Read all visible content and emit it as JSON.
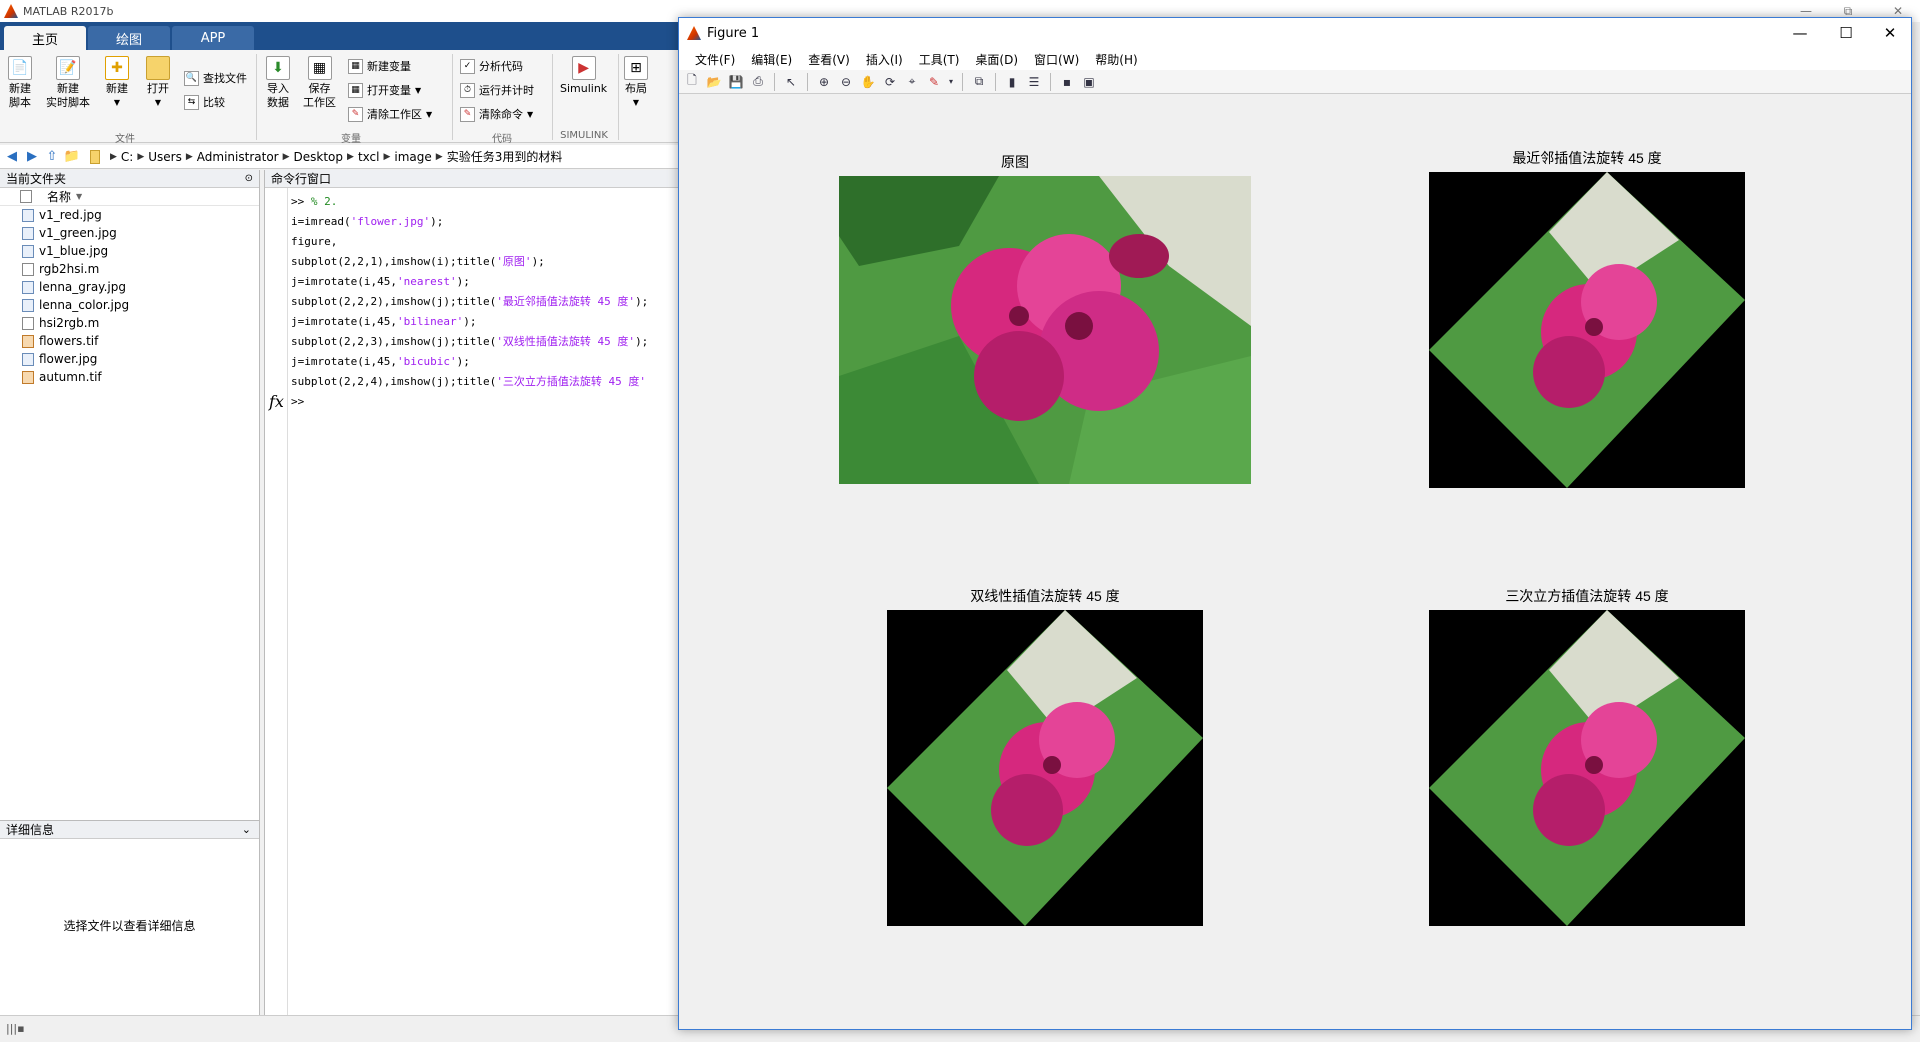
{
  "app_title": "MATLAB R2017b",
  "window_controls": {
    "minimize": "—",
    "restore": "⧉",
    "close": "✕"
  },
  "tabs": [
    "主页",
    "绘图",
    "APP"
  ],
  "ribbon": {
    "file": {
      "new_script": "新建\n脚本",
      "new_live_script": "新建\n实时脚本",
      "new": "新建",
      "open": "打开",
      "find_files": "查找文件",
      "compare": "比较",
      "group": "文件"
    },
    "variable": {
      "import": "导入\n数据",
      "save_ws": "保存\n工作区",
      "new_var": "新建变量",
      "open_var": "打开变量",
      "clear_ws": "清除工作区",
      "group": "变量"
    },
    "code": {
      "analyze": "分析代码",
      "run_time": "运行并计时",
      "clear_cmd": "清除命令",
      "group": "代码"
    },
    "simulink": {
      "label": "Simulink",
      "group": "SIMULINK"
    },
    "environment": {
      "layout": "布局"
    }
  },
  "address": {
    "crumbs": [
      "C:",
      "Users",
      "Administrator",
      "Desktop",
      "txcl",
      "image",
      "实验任务3用到的材料"
    ]
  },
  "current_folder": {
    "title": "当前文件夹",
    "column": "名称",
    "files": [
      {
        "name": "v1_red.jpg",
        "type": "img"
      },
      {
        "name": "v1_green.jpg",
        "type": "img"
      },
      {
        "name": "v1_blue.jpg",
        "type": "img"
      },
      {
        "name": "rgb2hsi.m",
        "type": "m"
      },
      {
        "name": "lenna_gray.jpg",
        "type": "img"
      },
      {
        "name": "lenna_color.jpg",
        "type": "img"
      },
      {
        "name": "hsi2rgb.m",
        "type": "m"
      },
      {
        "name": "flowers.tif",
        "type": "tif"
      },
      {
        "name": "flower.jpg",
        "type": "img"
      },
      {
        "name": "autumn.tif",
        "type": "tif"
      }
    ]
  },
  "details": {
    "title": "详细信息",
    "message": "选择文件以查看详细信息"
  },
  "command_window": {
    "title": "命令行窗口",
    "lines": [
      [
        {
          "t": ">> ",
          "c": ""
        },
        {
          "t": "% 2.",
          "c": "cmt"
        }
      ],
      [
        {
          "t": "i=imread(",
          "c": ""
        },
        {
          "t": "'flower.jpg'",
          "c": "str"
        },
        {
          "t": ");",
          "c": ""
        }
      ],
      [
        {
          "t": "figure,",
          "c": ""
        }
      ],
      [
        {
          "t": "subplot(2,2,1),imshow(i);title(",
          "c": ""
        },
        {
          "t": "'原图'",
          "c": "str"
        },
        {
          "t": ");",
          "c": ""
        }
      ],
      [
        {
          "t": "j=imrotate(i,45,",
          "c": ""
        },
        {
          "t": "'nearest'",
          "c": "str"
        },
        {
          "t": ");",
          "c": ""
        }
      ],
      [
        {
          "t": "subplot(2,2,2),imshow(j);title(",
          "c": ""
        },
        {
          "t": "'最近邻插值法旋转 45 度'",
          "c": "str"
        },
        {
          "t": ");",
          "c": ""
        }
      ],
      [
        {
          "t": "j=imrotate(i,45,",
          "c": ""
        },
        {
          "t": "'bilinear'",
          "c": "str"
        },
        {
          "t": ");",
          "c": ""
        }
      ],
      [
        {
          "t": "subplot(2,2,3),imshow(j);title(",
          "c": ""
        },
        {
          "t": "'双线性插值法旋转 45 度'",
          "c": "str"
        },
        {
          "t": ");",
          "c": ""
        }
      ],
      [
        {
          "t": "j=imrotate(i,45,",
          "c": ""
        },
        {
          "t": "'bicubic'",
          "c": "str"
        },
        {
          "t": ");",
          "c": ""
        }
      ],
      [
        {
          "t": "subplot(2,2,4),imshow(j);title(",
          "c": ""
        },
        {
          "t": "'三次立方插值法旋转 45 度'",
          "c": "str"
        },
        {
          "t": "",
          "c": ""
        }
      ]
    ],
    "prompt": ">>",
    "fx": "fx"
  },
  "figure": {
    "title": "Figure 1",
    "menu": [
      "文件(F)",
      "编辑(E)",
      "查看(V)",
      "插入(I)",
      "工具(T)",
      "桌面(D)",
      "窗口(W)",
      "帮助(H)"
    ],
    "subplots": [
      {
        "title": "原图",
        "rotated": false
      },
      {
        "title": "最近邻插值法旋转 45 度",
        "rotated": true
      },
      {
        "title": "双线性插值法旋转 45 度",
        "rotated": true
      },
      {
        "title": "三次立方插值法旋转 45 度",
        "rotated": true
      }
    ]
  },
  "colors": {
    "accent": "#1e4f8c",
    "string": "#a020f0",
    "comment": "#228b22",
    "flower": "#d6287e",
    "leaf": "#3f8f3a"
  }
}
